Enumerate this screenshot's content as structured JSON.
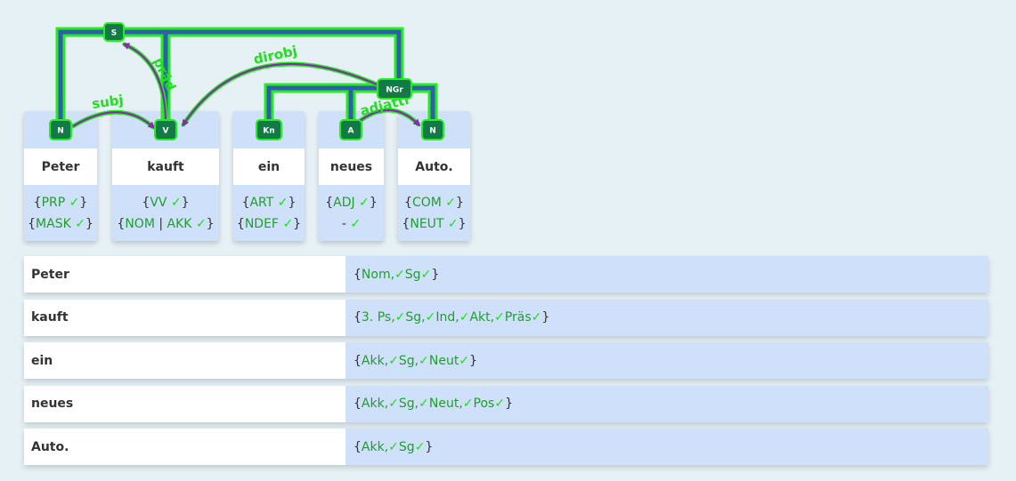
{
  "tree": {
    "nodes": {
      "S": "S",
      "N1": "N",
      "V": "V",
      "Kn": "Kn",
      "A": "A",
      "N2": "N",
      "NGr": "NGr"
    },
    "edges": {
      "subj": "subj",
      "praed": "präd",
      "dirobj": "dirobj",
      "adjattr": "adjattr"
    }
  },
  "cards": [
    {
      "word": "Peter",
      "f1": [
        {
          "t": "{"
        },
        {
          "g": "PRP"
        },
        {
          "t": " "
        },
        {
          "c": "✓"
        },
        {
          "t": "}"
        }
      ],
      "f2": [
        {
          "t": "{"
        },
        {
          "g": "MASK"
        },
        {
          "t": " "
        },
        {
          "c": "✓"
        },
        {
          "t": "}"
        }
      ]
    },
    {
      "word": "kauft",
      "f1": [
        {
          "t": "{"
        },
        {
          "g": "VV"
        },
        {
          "t": " "
        },
        {
          "c": "✓"
        },
        {
          "t": "}"
        }
      ],
      "f2": [
        {
          "t": "{"
        },
        {
          "g": "NOM"
        },
        {
          "t": " | "
        },
        {
          "g": "AKK"
        },
        {
          "t": " "
        },
        {
          "c": "✓"
        },
        {
          "t": "}"
        }
      ]
    },
    {
      "word": "ein",
      "f1": [
        {
          "t": "{"
        },
        {
          "g": "ART"
        },
        {
          "t": " "
        },
        {
          "c": "✓"
        },
        {
          "t": "}"
        }
      ],
      "f2": [
        {
          "t": "{"
        },
        {
          "g": "NDEF"
        },
        {
          "t": " "
        },
        {
          "c": "✓"
        },
        {
          "t": "}"
        }
      ]
    },
    {
      "word": "neues",
      "f1": [
        {
          "t": "{"
        },
        {
          "g": "ADJ"
        },
        {
          "t": " "
        },
        {
          "c": "✓"
        },
        {
          "t": "}"
        }
      ],
      "f2": [
        {
          "t": "- "
        },
        {
          "c": "✓"
        }
      ]
    },
    {
      "word": "Auto.",
      "f1": [
        {
          "t": "{"
        },
        {
          "g": "COM"
        },
        {
          "t": " "
        },
        {
          "c": "✓"
        },
        {
          "t": "}"
        }
      ],
      "f2": [
        {
          "t": "{"
        },
        {
          "g": "NEUT"
        },
        {
          "t": " "
        },
        {
          "c": "✓"
        },
        {
          "t": "}"
        }
      ]
    }
  ],
  "rows": [
    {
      "word": "Peter",
      "morph": [
        {
          "t": "{"
        },
        {
          "g": "Nom, "
        },
        {
          "c": "✓"
        },
        {
          "g": "Sg "
        },
        {
          "c": "✓"
        },
        {
          "t": "}"
        }
      ]
    },
    {
      "word": "kauft",
      "morph": [
        {
          "t": "{"
        },
        {
          "g": "3. Ps, "
        },
        {
          "c": "✓"
        },
        {
          "g": "Sg, "
        },
        {
          "c": "✓"
        },
        {
          "g": "Ind, "
        },
        {
          "c": "✓"
        },
        {
          "g": "Akt, "
        },
        {
          "c": "✓"
        },
        {
          "g": "Präs "
        },
        {
          "c": "✓"
        },
        {
          "t": "}"
        }
      ]
    },
    {
      "word": "ein",
      "morph": [
        {
          "t": "{"
        },
        {
          "g": "Akk, "
        },
        {
          "c": "✓"
        },
        {
          "g": "Sg, "
        },
        {
          "c": "✓"
        },
        {
          "g": "Neut "
        },
        {
          "c": "✓"
        },
        {
          "t": "}"
        }
      ]
    },
    {
      "word": "neues",
      "morph": [
        {
          "t": "{"
        },
        {
          "g": "Akk, "
        },
        {
          "c": "✓"
        },
        {
          "g": "Sg, "
        },
        {
          "c": "✓"
        },
        {
          "g": "Neut, "
        },
        {
          "c": "✓"
        },
        {
          "g": "Pos "
        },
        {
          "c": "✓"
        },
        {
          "t": "}"
        }
      ]
    },
    {
      "word": "Auto.",
      "morph": [
        {
          "t": "{"
        },
        {
          "g": "Akk, "
        },
        {
          "c": "✓"
        },
        {
          "g": "Sg "
        },
        {
          "c": "✓"
        },
        {
          "t": "}"
        }
      ]
    }
  ],
  "colors": {
    "edge_outer": "#22ee22",
    "edge_inner": "#2f5fa8",
    "node_fill": "#137a45",
    "arrow": "#8a2aa8",
    "card_bg": "#cfe0fb"
  }
}
